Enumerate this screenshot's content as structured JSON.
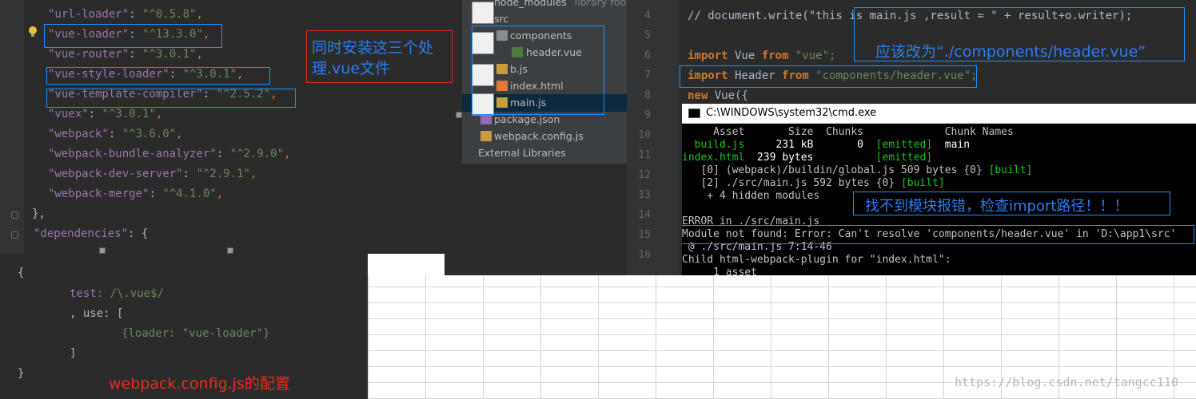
{
  "package_json": {
    "lines": [
      {
        "key": "\"url-loader\"",
        "val": "\"^0.5.8\""
      },
      {
        "key": "\"vue-loader\"",
        "val": "\"^13.3.0\""
      },
      {
        "key": "\"vue-router\"",
        "val": "\"^3.0.1\""
      },
      {
        "key": "\"vue-style-loader\"",
        "val": "\"^3.0.1\""
      },
      {
        "key": "\"vue-template-compiler\"",
        "val": "\"^2.5.2\""
      },
      {
        "key": "\"vuex\"",
        "val": "\"^3.0.1\""
      },
      {
        "key": "\"webpack\"",
        "val": "\"^3.6.0\""
      },
      {
        "key": "\"webpack-bundle-analyzer\"",
        "val": "\"^2.9.0\""
      },
      {
        "key": "\"webpack-dev-server\"",
        "val": "\"^2.9.1\""
      },
      {
        "key": "\"webpack-merge\"",
        "val": "\"^4.1.0\""
      }
    ],
    "close_brace": "},",
    "dependencies_key": "\"dependencies\"",
    "dependencies_open": ": {",
    "annotation": "同时安装这三个处理.vue文件"
  },
  "project_tree": {
    "items": {
      "node_modules": "node_modules",
      "library_root": "library root",
      "src": "src",
      "components": "components",
      "header_vue": "header.vue",
      "b_js": "b.js",
      "index_html": "index.html",
      "main_js": "main.js",
      "package_json": "package.json",
      "webpack_config": "webpack.config.js",
      "external_libraries": "External Libraries"
    }
  },
  "editor": {
    "line_numbers": [
      "4",
      "5",
      "6",
      "7",
      "8",
      "9",
      "10",
      "11",
      "12",
      "13",
      "14",
      "15",
      "16"
    ],
    "line4": "// document.write(\"this is main.js ,result = \" + result+o.writer);",
    "line6_kw": "import",
    "line6_rest": " Vue ",
    "line6_from": "from",
    "line6_str": " \"vue\";",
    "line7_kw": "import",
    "line7_rest": " Header ",
    "line7_from": "from",
    "line7_str": " \"components/header.vue\";",
    "line8_kw": "new",
    "line8_rest": " Vue({",
    "annotation": "应该改为“./components/header.vue”"
  },
  "cmd": {
    "title": "C:\\WINDOWS\\system32\\cmd.exe",
    "header": "     Asset       Size  Chunks             Chunk Names",
    "row1_name": "  build.js",
    "row1_rest": "     231 kB       0  ",
    "row1_emitted": "[emitted]",
    "row1_chunk": "  main",
    "row2_name": "index.html",
    "row2_rest": "  239 bytes          ",
    "row2_emitted": "[emitted]",
    "row3": "   [0] (webpack)/buildin/global.js 509 bytes {0} ",
    "row3_built": "[built]",
    "row4": "   [2] ./src/main.js 592 bytes {0} ",
    "row4_built": "[built]",
    "row5": "    + 4 hidden modules",
    "error1": "ERROR in ./src/main.js",
    "error2": "Module not found: Error: Can't resolve 'components/header.vue' in 'D:\\app1\\src'",
    "error3": " @ ./src/main.js 7:14-46",
    "child": "Child html-webpack-plugin for \"index.html\":",
    "asset": "     1 asset",
    "annotation": "找不到模块报错，检查import路径！！！"
  },
  "webpack_config": {
    "open": "{",
    "test_key": "test",
    "test_val": ": /\\.vue$/",
    "use_line": ", use: [",
    "loader_line": "{loader: \"vue-loader\"}",
    "close_bracket": "]",
    "close_brace": "}",
    "annotation": "webpack.config.js的配置"
  },
  "watermark": "https://blog.csdn.net/tangcc110",
  "colors": {
    "accent_blue": "#1e90ff",
    "annotation_red": "#e52c1e",
    "annotation_blue": "#2a7df0"
  }
}
